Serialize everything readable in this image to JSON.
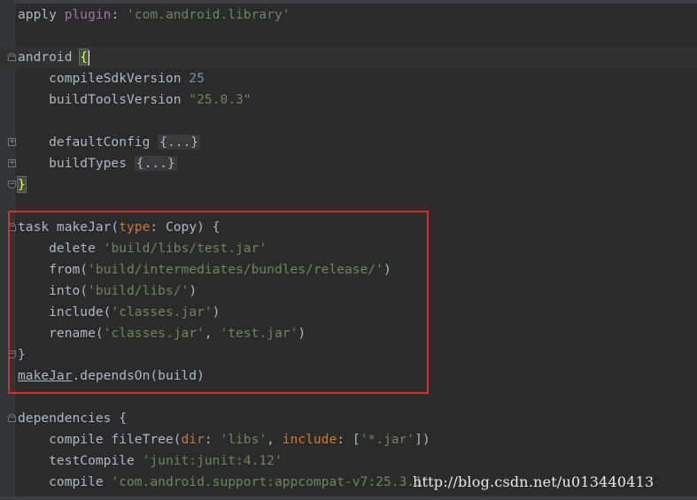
{
  "editor": {
    "lines": [
      {
        "segments": [
          {
            "t": "apply ",
            "c": ""
          },
          {
            "t": "plugin",
            "c": "plugin"
          },
          {
            "t": ": ",
            "c": ""
          },
          {
            "t": "'com.android.library'",
            "c": "str"
          }
        ],
        "fold": ""
      },
      {
        "segments": [],
        "fold": ""
      },
      {
        "segments": [
          {
            "t": "android ",
            "c": ""
          },
          {
            "t": "{",
            "c": "brace-hl"
          }
        ],
        "fold": "start",
        "caret": true,
        "current": true
      },
      {
        "segments": [
          {
            "t": "    compileSdkVersion ",
            "c": ""
          },
          {
            "t": "25",
            "c": "num"
          }
        ],
        "fold": ""
      },
      {
        "segments": [
          {
            "t": "    buildToolsVersion ",
            "c": ""
          },
          {
            "t": "\"25.0.3\"",
            "c": "str"
          }
        ],
        "fold": ""
      },
      {
        "segments": [],
        "fold": ""
      },
      {
        "segments": [
          {
            "t": "    defaultConfig ",
            "c": ""
          },
          {
            "t": "{...}",
            "c": "collapsed"
          }
        ],
        "fold": "plus"
      },
      {
        "segments": [
          {
            "t": "    buildTypes ",
            "c": ""
          },
          {
            "t": "{...}",
            "c": "collapsed"
          }
        ],
        "fold": "plus"
      },
      {
        "segments": [
          {
            "t": "}",
            "c": "brace-hl"
          }
        ],
        "fold": "end"
      },
      {
        "segments": [],
        "fold": ""
      },
      {
        "segments": [
          {
            "t": "task makeJar(",
            "c": ""
          },
          {
            "t": "type",
            "c": "param"
          },
          {
            "t": ": Copy) {",
            "c": ""
          }
        ],
        "fold": "start"
      },
      {
        "segments": [
          {
            "t": "    delete ",
            "c": ""
          },
          {
            "t": "'build/libs/test.jar'",
            "c": "str"
          }
        ],
        "fold": ""
      },
      {
        "segments": [
          {
            "t": "    from(",
            "c": ""
          },
          {
            "t": "'build/intermediates/bundles/release/'",
            "c": "str"
          },
          {
            "t": ")",
            "c": ""
          }
        ],
        "fold": ""
      },
      {
        "segments": [
          {
            "t": "    into(",
            "c": ""
          },
          {
            "t": "'build/libs/'",
            "c": "str"
          },
          {
            "t": ")",
            "c": ""
          }
        ],
        "fold": ""
      },
      {
        "segments": [
          {
            "t": "    include(",
            "c": ""
          },
          {
            "t": "'classes.jar'",
            "c": "str"
          },
          {
            "t": ")",
            "c": ""
          }
        ],
        "fold": ""
      },
      {
        "segments": [
          {
            "t": "    rename(",
            "c": ""
          },
          {
            "t": "'classes.jar'",
            "c": "str"
          },
          {
            "t": ", ",
            "c": ""
          },
          {
            "t": "'test.jar'",
            "c": "str"
          },
          {
            "t": ")",
            "c": ""
          }
        ],
        "fold": ""
      },
      {
        "segments": [
          {
            "t": "}",
            "c": ""
          }
        ],
        "fold": "end"
      },
      {
        "segments": [
          {
            "t": "makeJar",
            "c": "link"
          },
          {
            "t": ".dependsOn(build)",
            "c": ""
          }
        ],
        "fold": ""
      },
      {
        "segments": [],
        "fold": ""
      },
      {
        "segments": [
          {
            "t": "dependencies {",
            "c": ""
          }
        ],
        "fold": "start"
      },
      {
        "segments": [
          {
            "t": "    compile fileTree(",
            "c": ""
          },
          {
            "t": "dir",
            "c": "param"
          },
          {
            "t": ": ",
            "c": ""
          },
          {
            "t": "'libs'",
            "c": "str"
          },
          {
            "t": ", ",
            "c": ""
          },
          {
            "t": "include",
            "c": "param"
          },
          {
            "t": ": [",
            "c": ""
          },
          {
            "t": "'*.jar'",
            "c": "str"
          },
          {
            "t": "])",
            "c": ""
          }
        ],
        "fold": ""
      },
      {
        "segments": [
          {
            "t": "    testCompile ",
            "c": ""
          },
          {
            "t": "'junit:junit:4.12'",
            "c": "str"
          }
        ],
        "fold": ""
      },
      {
        "segments": [
          {
            "t": "    compile ",
            "c": ""
          },
          {
            "t": "'com.android.support:appcompat-v7:25.3.1'",
            "c": "str"
          }
        ],
        "fold": ""
      }
    ]
  },
  "colors": {
    "background": "#2b2b2b",
    "string": "#6a8759",
    "number": "#6897bb",
    "keyword": "#cc7832",
    "highlight_box": "#e02a2a"
  },
  "watermark": {
    "text": "http://blog.csdn.net/u013440413"
  }
}
